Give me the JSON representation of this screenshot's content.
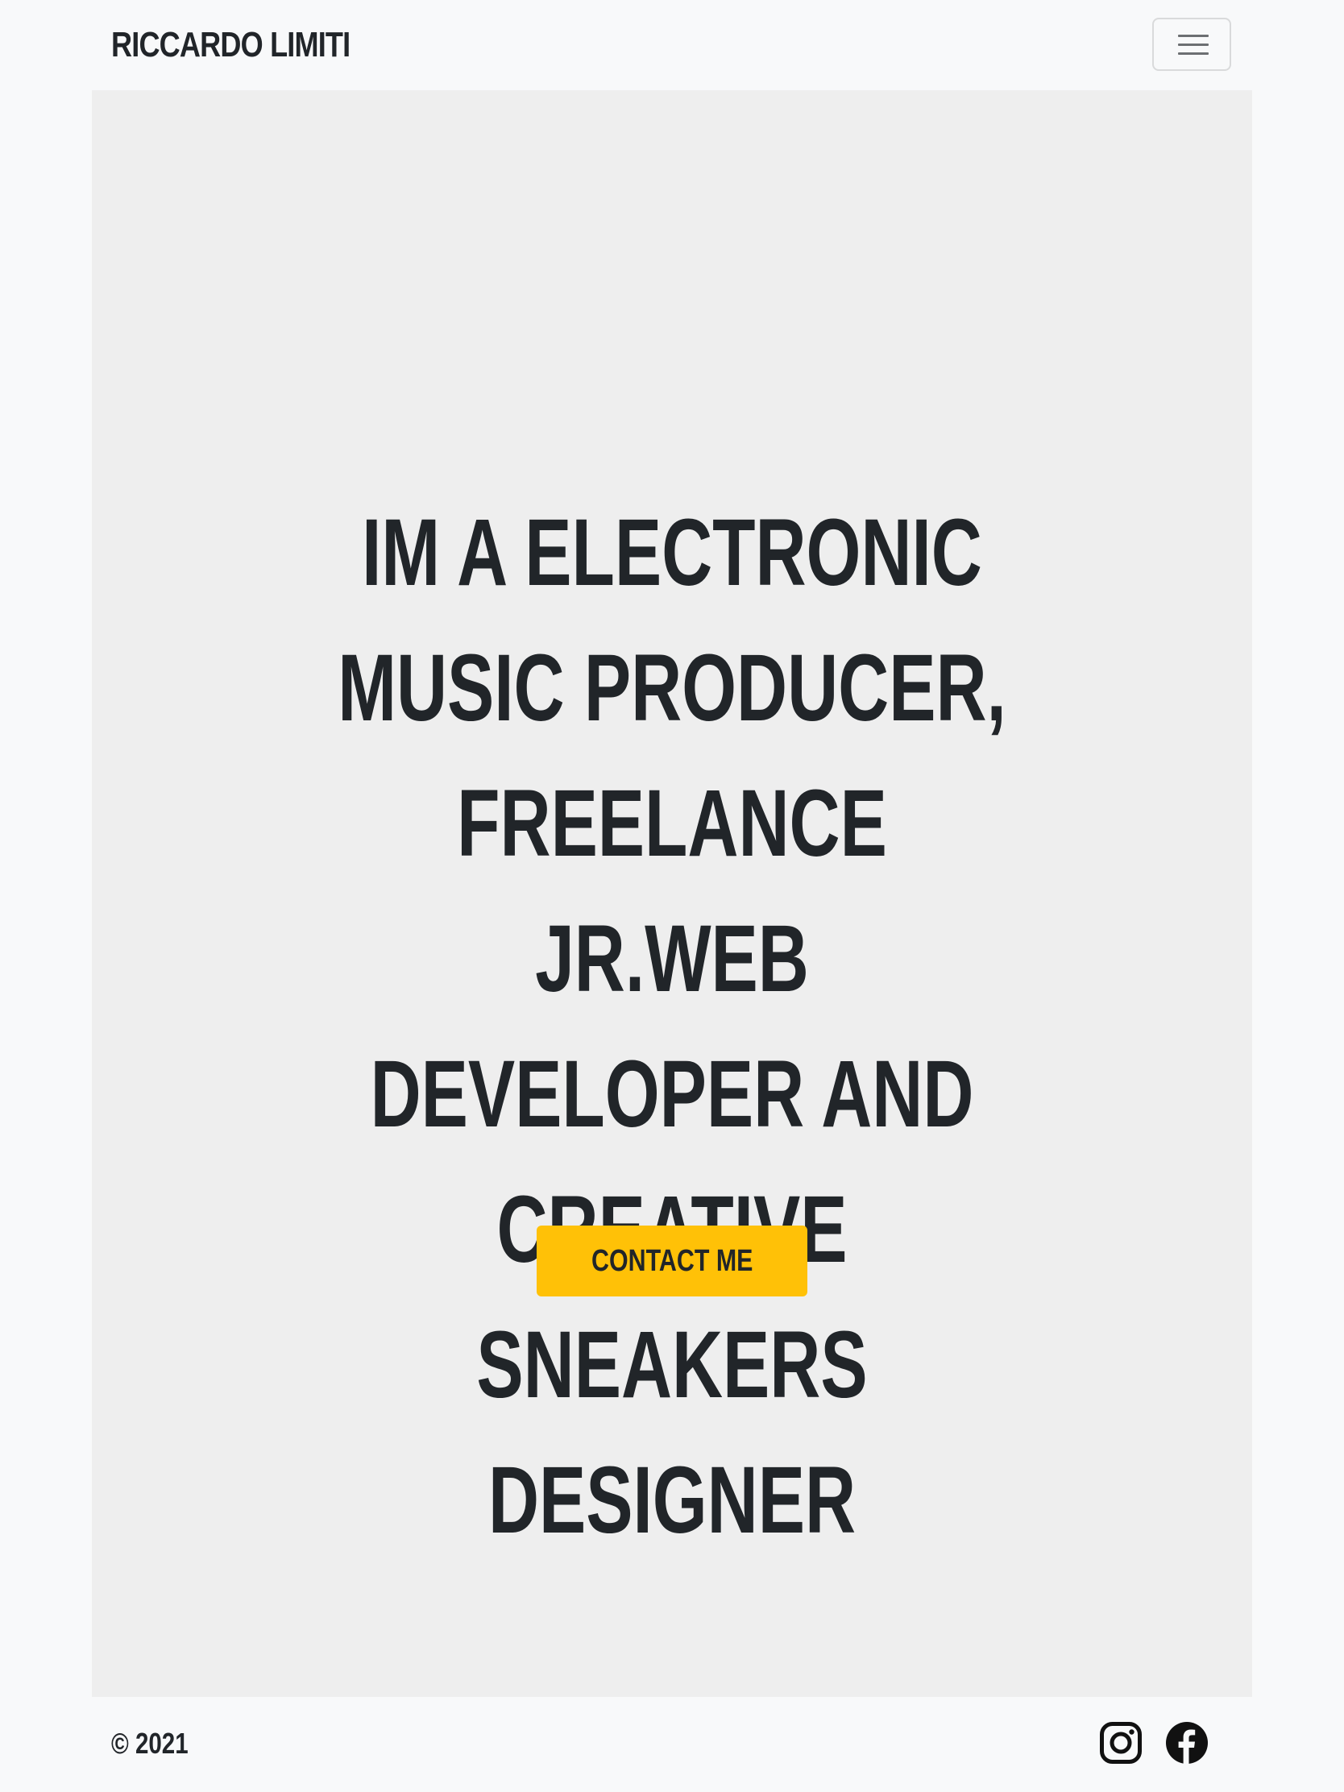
{
  "navbar": {
    "brand": "RICCARDO LIMITI",
    "toggler_icon": "hamburger-menu-icon"
  },
  "hero": {
    "headline": "IM A ELECTRONIC MUSIC PRODUCER, FREELANCE JR.WEB DEVELOPER AND CREATIVE SNEAKERS DESIGNER",
    "cta_label": "CONTACT ME"
  },
  "footer": {
    "copyright": "© 2021",
    "social": [
      {
        "icon": "instagram-icon"
      },
      {
        "icon": "facebook-icon"
      }
    ]
  },
  "colors": {
    "background": "#f8f9fa",
    "hero_background": "#eeeeee",
    "text": "#212529",
    "cta": "#ffc107"
  }
}
